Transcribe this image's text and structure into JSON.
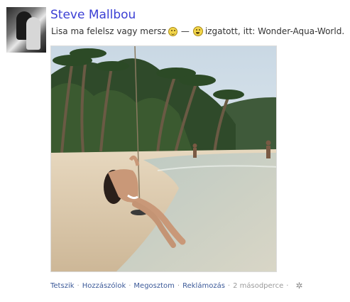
{
  "post": {
    "author": "Steve Mallbou",
    "status_text": "Lisa ma felelsz vagy mersz",
    "status_dash": "—",
    "feeling_text": "izgatott, itt: Wonder-Aqua-World.",
    "emoji_1": "smile-emoji-icon",
    "emoji_2": "grin-emoji-icon"
  },
  "actions": {
    "like": "Tetszik",
    "comment": "Hozzászólok",
    "share": "Megosztom",
    "promote": "Reklámozás",
    "time": "2 másodperce",
    "separator": "·",
    "settings_icon": "gear-icon"
  },
  "colors": {
    "author_link": "#3b3fd4",
    "action_link": "#3b5998",
    "meta_text": "#9a9a9a"
  }
}
